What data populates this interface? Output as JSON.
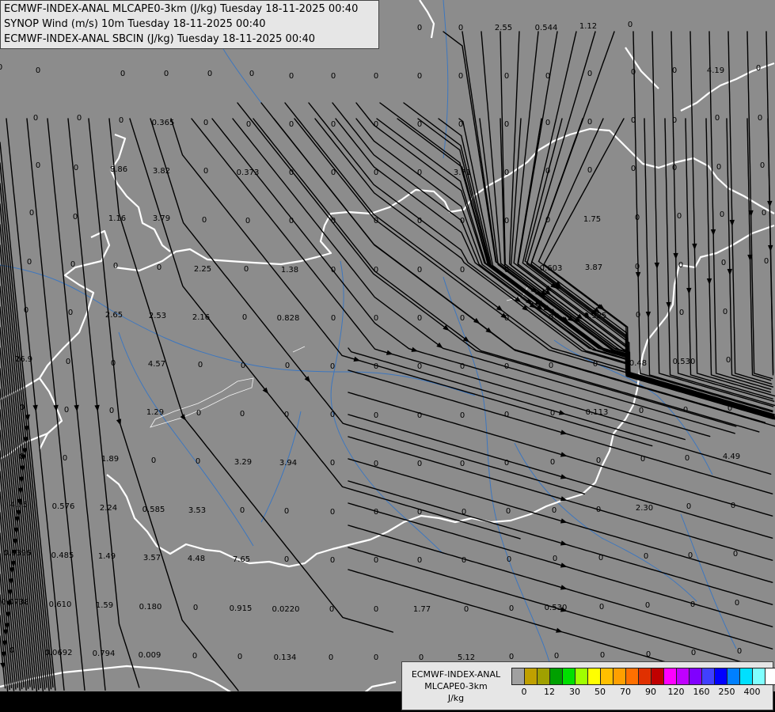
{
  "titles": [
    "ECMWF-INDEX-ANAL MLCAPE0-3km (J/kg) Tuesday 18-11-2025 00:40",
    "SYNOP Wind (m/s) 10m Tuesday 18-11-2025 00:40",
    "ECMWF-INDEX-ANAL SBCIN (J/kg) Tuesday 18-11-2025 00:40"
  ],
  "legend": {
    "title_line1": "ECMWF-INDEX-ANAL",
    "title_line2": "MLCAPE0-3km",
    "units": "J/kg",
    "colors": [
      "#a0a0a0",
      "#c0a000",
      "#a0a000",
      "#00a000",
      "#00e000",
      "#a0ff00",
      "#ffff00",
      "#ffc000",
      "#ffa000",
      "#ff7000",
      "#e03000",
      "#c00000",
      "#ff00ff",
      "#c000ff",
      "#8000ff",
      "#4040ff",
      "#0000ff",
      "#0080ff",
      "#00e0ff",
      "#80ffff",
      "#ffffff"
    ],
    "ticks": [
      {
        "label": "0",
        "at": 1
      },
      {
        "label": "12",
        "at": 3
      },
      {
        "label": "30",
        "at": 5
      },
      {
        "label": "50",
        "at": 7
      },
      {
        "label": "70",
        "at": 9
      },
      {
        "label": "90",
        "at": 11
      },
      {
        "label": "120",
        "at": 13
      },
      {
        "label": "160",
        "at": 15
      },
      {
        "label": "250",
        "at": 17
      },
      {
        "label": "400",
        "at": 19
      }
    ]
  },
  "values": [
    [
      "0",
      48,
      92
    ],
    [
      "0",
      155,
      96
    ],
    [
      "0",
      210,
      96
    ],
    [
      "0",
      265,
      96
    ],
    [
      "0",
      318,
      96
    ],
    [
      "0",
      368,
      99
    ],
    [
      "0",
      421,
      99
    ],
    [
      "0",
      475,
      99
    ],
    [
      "0",
      530,
      99
    ],
    [
      "0",
      582,
      99
    ],
    [
      "0",
      640,
      99
    ],
    [
      "0",
      692,
      99
    ],
    [
      "0",
      745,
      96
    ],
    [
      "0",
      800,
      94
    ],
    [
      "0",
      852,
      92
    ],
    [
      "4.19",
      904,
      92
    ],
    [
      "0",
      958,
      89
    ],
    [
      "0",
      45,
      152
    ],
    [
      "0",
      100,
      152
    ],
    [
      "0",
      153,
      155
    ],
    [
      "0.365",
      206,
      158
    ],
    [
      "0",
      260,
      158
    ],
    [
      "0",
      314,
      160
    ],
    [
      "0",
      368,
      160
    ],
    [
      "0",
      421,
      160
    ],
    [
      "0",
      475,
      160
    ],
    [
      "0",
      530,
      160
    ],
    [
      "0",
      582,
      160
    ],
    [
      "0",
      640,
      160
    ],
    [
      "0",
      692,
      158
    ],
    [
      "0",
      745,
      157
    ],
    [
      "0",
      800,
      155
    ],
    [
      "0",
      852,
      155
    ],
    [
      "0",
      906,
      152
    ],
    [
      "0",
      960,
      152
    ],
    [
      "0",
      48,
      212
    ],
    [
      "0",
      96,
      215
    ],
    [
      "8.86",
      150,
      217
    ],
    [
      "3.82",
      204,
      219
    ],
    [
      "0",
      260,
      219
    ],
    [
      "0.373",
      313,
      221
    ],
    [
      "0",
      368,
      221
    ],
    [
      "0",
      421,
      221
    ],
    [
      "0",
      475,
      221
    ],
    [
      "0",
      530,
      221
    ],
    [
      "3.71",
      584,
      221
    ],
    [
      "0",
      640,
      221
    ],
    [
      "0",
      692,
      219
    ],
    [
      "0",
      745,
      218
    ],
    [
      "0",
      800,
      216
    ],
    [
      "0",
      852,
      215
    ],
    [
      "0",
      908,
      214
    ],
    [
      "0",
      963,
      212
    ],
    [
      "0",
      40,
      272
    ],
    [
      "0",
      95,
      277
    ],
    [
      "1.16",
      148,
      279
    ],
    [
      "3.79",
      204,
      279
    ],
    [
      "0",
      258,
      281
    ],
    [
      "0",
      313,
      282
    ],
    [
      "0",
      368,
      282
    ],
    [
      "0",
      421,
      282
    ],
    [
      "0",
      475,
      282
    ],
    [
      "0",
      530,
      282
    ],
    [
      "0",
      584,
      282
    ],
    [
      "0",
      640,
      282
    ],
    [
      "0",
      692,
      281
    ],
    [
      "1.75",
      748,
      280
    ],
    [
      "0",
      805,
      278
    ],
    [
      "0",
      858,
      276
    ],
    [
      "0",
      912,
      274
    ],
    [
      "0",
      965,
      272
    ],
    [
      "0",
      37,
      334
    ],
    [
      "0",
      92,
      337
    ],
    [
      "0",
      146,
      339
    ],
    [
      "0",
      201,
      341
    ],
    [
      "2.25",
      256,
      343
    ],
    [
      "0",
      311,
      343
    ],
    [
      "1.38",
      366,
      344
    ],
    [
      "0",
      421,
      344
    ],
    [
      "0",
      475,
      344
    ],
    [
      "0",
      530,
      344
    ],
    [
      "0",
      584,
      344
    ],
    [
      "0",
      640,
      344
    ],
    [
      "0.603",
      696,
      342
    ],
    [
      "3.87",
      750,
      341
    ],
    [
      "0",
      805,
      340
    ],
    [
      "0",
      860,
      338
    ],
    [
      "0",
      914,
      335
    ],
    [
      "0",
      968,
      333
    ],
    [
      "0",
      33,
      395
    ],
    [
      "0",
      89,
      398
    ],
    [
      "2.65",
      144,
      401
    ],
    [
      "2.53",
      199,
      402
    ],
    [
      "2.16",
      254,
      404
    ],
    [
      "0",
      309,
      404
    ],
    [
      "0.828",
      364,
      405
    ],
    [
      "0",
      421,
      405
    ],
    [
      "0",
      475,
      405
    ],
    [
      "0",
      530,
      405
    ],
    [
      "0",
      584,
      405
    ],
    [
      "0",
      640,
      405
    ],
    [
      "0",
      696,
      404
    ],
    [
      "0.925",
      752,
      402
    ],
    [
      "0",
      806,
      401
    ],
    [
      "0",
      861,
      398
    ],
    [
      "0",
      916,
      397
    ],
    [
      "26.9",
      30,
      457
    ],
    [
      "0",
      86,
      460
    ],
    [
      "0",
      143,
      462
    ],
    [
      "4.57",
      198,
      463
    ],
    [
      "0",
      253,
      464
    ],
    [
      "0",
      307,
      465
    ],
    [
      "0",
      363,
      465
    ],
    [
      "0",
      420,
      466
    ],
    [
      "0",
      475,
      466
    ],
    [
      "0",
      530,
      466
    ],
    [
      "0",
      584,
      466
    ],
    [
      "0",
      640,
      466
    ],
    [
      "0",
      696,
      465
    ],
    [
      "0",
      752,
      463
    ],
    [
      "0.48",
      806,
      462
    ],
    [
      "0.530",
      864,
      460
    ],
    [
      "0",
      920,
      458
    ],
    [
      "0",
      28,
      518
    ],
    [
      "0",
      84,
      521
    ],
    [
      "0",
      141,
      522
    ],
    [
      "1.29",
      196,
      524
    ],
    [
      "0",
      251,
      525
    ],
    [
      "0",
      306,
      526
    ],
    [
      "0",
      362,
      527
    ],
    [
      "0",
      420,
      527
    ],
    [
      "0",
      475,
      528
    ],
    [
      "0",
      530,
      528
    ],
    [
      "0",
      584,
      528
    ],
    [
      "0",
      640,
      527
    ],
    [
      "0",
      698,
      525
    ],
    [
      "0.113",
      754,
      524
    ],
    [
      "0",
      810,
      522
    ],
    [
      "0",
      866,
      521
    ],
    [
      "0",
      922,
      519
    ],
    [
      "0",
      27,
      580
    ],
    [
      "0",
      82,
      582
    ],
    [
      "1.89",
      139,
      583
    ],
    [
      "0",
      194,
      585
    ],
    [
      "0",
      250,
      586
    ],
    [
      "3.29",
      307,
      587
    ],
    [
      "3.94",
      364,
      588
    ],
    [
      "0",
      420,
      588
    ],
    [
      "0",
      475,
      589
    ],
    [
      "0",
      530,
      589
    ],
    [
      "0",
      584,
      589
    ],
    [
      "0",
      640,
      588
    ],
    [
      "0",
      698,
      587
    ],
    [
      "0",
      756,
      585
    ],
    [
      "0",
      812,
      583
    ],
    [
      "0",
      868,
      582
    ],
    [
      "4.49",
      924,
      580
    ],
    [
      "4.75",
      24,
      641
    ],
    [
      "0.576",
      80,
      643
    ],
    [
      "2.24",
      137,
      645
    ],
    [
      "0.585",
      194,
      647
    ],
    [
      "3.53",
      249,
      648
    ],
    [
      "0",
      306,
      648
    ],
    [
      "0",
      362,
      649
    ],
    [
      "0",
      420,
      650
    ],
    [
      "0",
      475,
      650
    ],
    [
      "0",
      530,
      650
    ],
    [
      "0",
      586,
      650
    ],
    [
      "0",
      642,
      649
    ],
    [
      "0",
      700,
      648
    ],
    [
      "0",
      756,
      647
    ],
    [
      "2.30",
      814,
      645
    ],
    [
      "0",
      870,
      643
    ],
    [
      "0",
      926,
      642
    ],
    [
      "0.0396",
      22,
      702
    ],
    [
      "0.485",
      79,
      705
    ],
    [
      "1.49",
      135,
      706
    ],
    [
      "3.57",
      192,
      708
    ],
    [
      "4.48",
      248,
      709
    ],
    [
      "7.65",
      305,
      710
    ],
    [
      "0",
      362,
      710
    ],
    [
      "0",
      420,
      711
    ],
    [
      "0",
      475,
      711
    ],
    [
      "0",
      530,
      711
    ],
    [
      "0",
      586,
      711
    ],
    [
      "0",
      643,
      710
    ],
    [
      "0",
      701,
      709
    ],
    [
      "0",
      759,
      708
    ],
    [
      "0",
      816,
      706
    ],
    [
      "0",
      872,
      705
    ],
    [
      "0",
      929,
      703
    ],
    [
      "0.0738",
      19,
      764
    ],
    [
      "0.610",
      76,
      767
    ],
    [
      "1.59",
      132,
      768
    ],
    [
      "0.180",
      190,
      770
    ],
    [
      "0",
      247,
      771
    ],
    [
      "0.915",
      304,
      772
    ],
    [
      "0.0220",
      361,
      773
    ],
    [
      "0",
      419,
      773
    ],
    [
      "0",
      475,
      773
    ],
    [
      "1.77",
      533,
      773
    ],
    [
      "0",
      589,
      773
    ],
    [
      "0",
      646,
      772
    ],
    [
      "0.530",
      702,
      771
    ],
    [
      "0",
      760,
      770
    ],
    [
      "0",
      818,
      768
    ],
    [
      "0",
      875,
      767
    ],
    [
      "0",
      931,
      765
    ],
    [
      "0",
      15,
      825
    ],
    [
      "0.0692",
      74,
      828
    ],
    [
      "0.794",
      131,
      829
    ],
    [
      "0.009",
      189,
      831
    ],
    [
      "0",
      246,
      832
    ],
    [
      "0",
      303,
      833
    ],
    [
      "0.134",
      360,
      834
    ],
    [
      "0",
      418,
      834
    ],
    [
      "0",
      475,
      834
    ],
    [
      "0",
      532,
      834
    ],
    [
      "5.12",
      589,
      834
    ],
    [
      "0",
      646,
      833
    ],
    [
      "0",
      703,
      832
    ],
    [
      "0",
      761,
      831
    ],
    [
      "0",
      819,
      830
    ],
    [
      "0",
      876,
      828
    ],
    [
      "0",
      934,
      826
    ],
    [
      "2.55",
      636,
      38
    ],
    [
      "0.544",
      690,
      38
    ],
    [
      "1.12",
      743,
      36
    ],
    [
      "0",
      796,
      34
    ],
    [
      "0",
      530,
      38
    ],
    [
      "0",
      582,
      38
    ],
    [
      "0",
      0,
      88
    ]
  ]
}
